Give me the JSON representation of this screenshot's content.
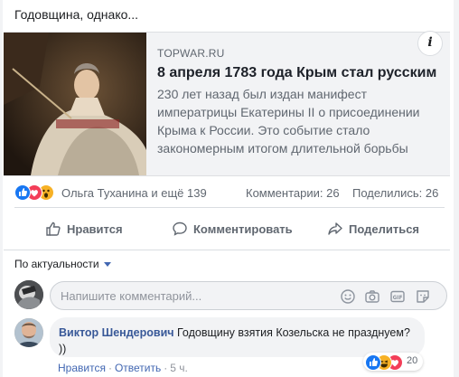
{
  "post": {
    "text": "Годовщина, однако..."
  },
  "link": {
    "domain": "TOPWAR.RU",
    "title": "8 апреля 1783 года Крым стал русским",
    "description": "230 лет назад был издан манифест императрицы Екатерины II о присоединении Крыма к России. Это событие стало закономерным итогом длительной борьбы",
    "info_label": "i"
  },
  "stats": {
    "reaction_icons": [
      "like-reaction",
      "love-reaction",
      "wow-reaction"
    ],
    "reactors_text": "Ольга Туханина и ещё 139",
    "comments_text": "Комментарии: 26",
    "shares_text": "Поделились: 26"
  },
  "actions": {
    "like": "Нравится",
    "comment": "Комментировать",
    "share": "Поделиться"
  },
  "comments_section": {
    "sort_label": "По актуальности",
    "input_placeholder": "Напишите комментарий...",
    "input_icons": [
      "emoji-icon",
      "camera-icon",
      "gif-icon",
      "sticker-icon"
    ]
  },
  "comment": {
    "author": "Виктор Шендерович",
    "text": "Годовщину взятия Козельска не празднуем? ))",
    "reaction_icons": [
      "like-reaction",
      "haha-reaction",
      "love-reaction"
    ],
    "reaction_count": "20",
    "like_action": "Нравится",
    "reply_action": "Ответить",
    "time": "5 ч."
  },
  "colors": {
    "link_blue": "#385898",
    "accent_blue": "#4267b2",
    "like_blue": "#1877f2",
    "love_red": "#f33e58",
    "wow_yellow": "#f7b125"
  }
}
